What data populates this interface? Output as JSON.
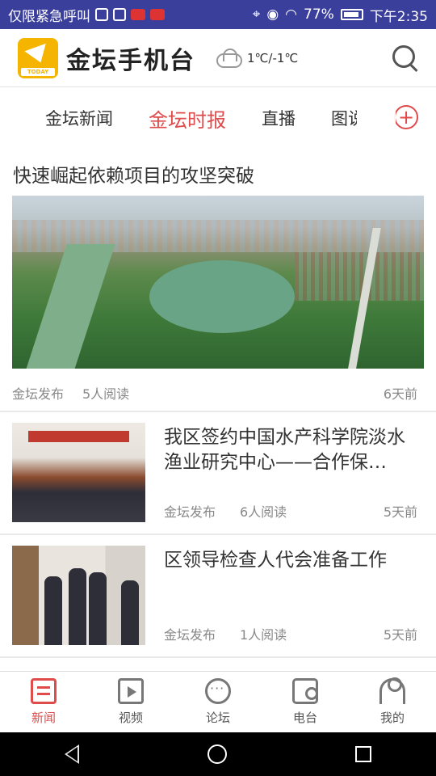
{
  "status_bar": {
    "left_text": "仅限紧急呼叫",
    "battery": "77%",
    "time": "下午2:35"
  },
  "header": {
    "logo_text": "TODAY",
    "title": "金坛手机台",
    "weather": "1℃/-1℃"
  },
  "tabs": [
    {
      "label": "金坛新闻"
    },
    {
      "label": "金坛时报"
    },
    {
      "label": "直播"
    },
    {
      "label": "图说"
    }
  ],
  "add_tab_label": "+",
  "featured": {
    "title": "快速崛起依赖项目的攻坚突破",
    "source": "金坛发布",
    "reads": "5人阅读",
    "time": "6天前"
  },
  "articles": [
    {
      "title": "我区签约中国水产科学院淡水渔业研究中心——合作保…",
      "source": "金坛发布",
      "reads": "6人阅读",
      "time": "5天前"
    },
    {
      "title": "区领导检查人代会准备工作",
      "source": "金坛发布",
      "reads": "1人阅读",
      "time": "5天前"
    }
  ],
  "nav": [
    {
      "label": "新闻"
    },
    {
      "label": "视频"
    },
    {
      "label": "论坛"
    },
    {
      "label": "电台"
    },
    {
      "label": "我的"
    }
  ]
}
